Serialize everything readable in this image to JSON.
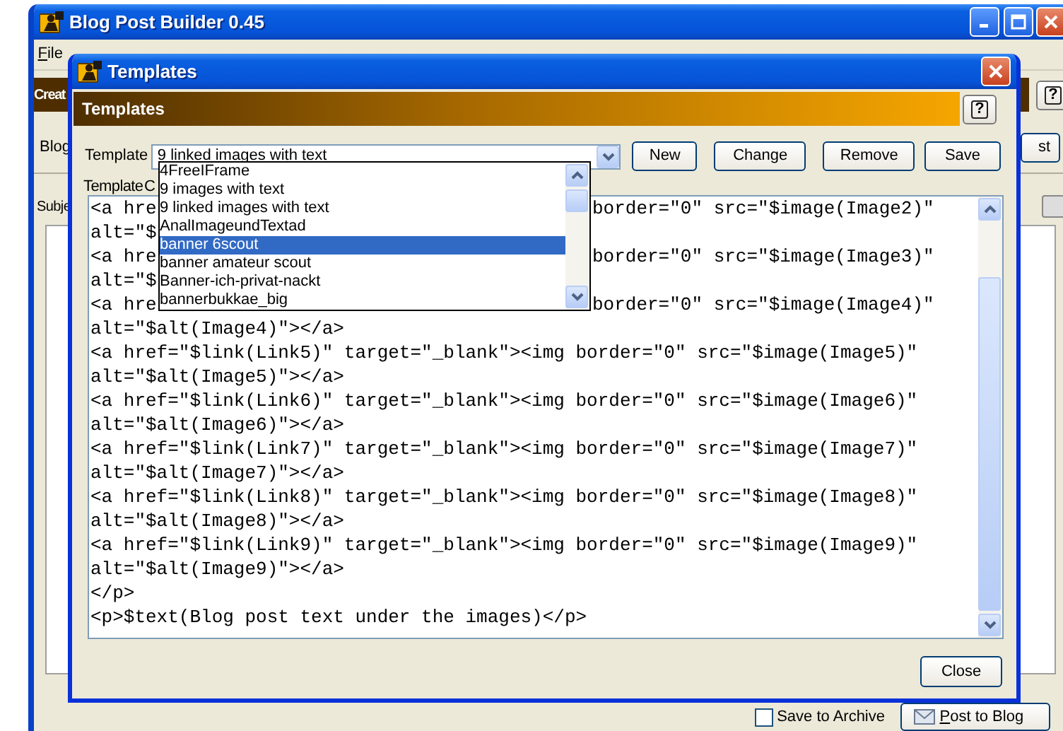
{
  "main_window": {
    "title": "Blog Post Builder 0.45",
    "menu": [
      {
        "label": "File"
      }
    ],
    "header_text": "Creat",
    "help_button": "?",
    "blog_label": "Blog",
    "partial_button": "st",
    "subject_label": "Subje",
    "save_to_archive": {
      "label": "Save to Archive",
      "checked": false
    },
    "post_button": "Post to Blog"
  },
  "dialog": {
    "title": "Templates",
    "header": "Templates",
    "help_button": "?",
    "template_label": "Template",
    "template_value": "9 linked images with text",
    "buttons": [
      "New",
      "Change",
      "Remove",
      "Save"
    ],
    "code_label": "Template C",
    "code_lines": [
      {
        "parts": [
          "<a hre",
          "border=\"0\" src=\"$image(Image2)\""
        ]
      },
      {
        "parts": [
          "alt=\"$"
        ]
      },
      {
        "parts": [
          "<a hre",
          "border=\"0\" src=\"$image(Image3)\""
        ]
      },
      {
        "parts": [
          "alt=\"$"
        ]
      },
      {
        "parts": [
          "<a hre",
          "border=\"0\" src=\"$image(Image4)\""
        ]
      },
      {
        "parts": [
          "alt=\"$alt(Image4)\"></a>"
        ]
      },
      {
        "parts": [
          "<a href=\"$link(Link5)\" target=\"_blank\"><img border=\"0\" src=\"$image(Image5)\""
        ]
      },
      {
        "parts": [
          "alt=\"$alt(Image5)\"></a>"
        ]
      },
      {
        "parts": [
          "<a href=\"$link(Link6)\" target=\"_blank\"><img border=\"0\" src=\"$image(Image6)\""
        ]
      },
      {
        "parts": [
          "alt=\"$alt(Image6)\"></a>"
        ]
      },
      {
        "parts": [
          "<a href=\"$link(Link7)\" target=\"_blank\"><img border=\"0\" src=\"$image(Image7)\""
        ]
      },
      {
        "parts": [
          "alt=\"$alt(Image7)\"></a>"
        ]
      },
      {
        "parts": [
          "<a href=\"$link(Link8)\" target=\"_blank\"><img border=\"0\" src=\"$image(Image8)\""
        ]
      },
      {
        "parts": [
          "alt=\"$alt(Image8)\"></a>"
        ]
      },
      {
        "parts": [
          "<a href=\"$link(Link9)\" target=\"_blank\"><img border=\"0\" src=\"$image(Image9)\""
        ]
      },
      {
        "parts": [
          "alt=\"$alt(Image9)\"></a>"
        ]
      },
      {
        "parts": [
          "</p>"
        ]
      },
      {
        "parts": [
          "<p>$text(Blog post text under the images)</p>"
        ]
      }
    ],
    "close_button": "Close"
  },
  "dropdown": {
    "items": [
      {
        "label": "4FreeIFrame",
        "selected": false
      },
      {
        "label": "9 images with text",
        "selected": false
      },
      {
        "label": "9 linked images with text",
        "selected": false
      },
      {
        "label": "AnalImageundTextad",
        "selected": false
      },
      {
        "label": "banner 6scout",
        "selected": true
      },
      {
        "label": "banner amateur scout",
        "selected": false
      },
      {
        "label": "Banner-ich-privat-nackt",
        "selected": false
      },
      {
        "label": "bannerbukkae_big",
        "selected": false
      }
    ]
  }
}
